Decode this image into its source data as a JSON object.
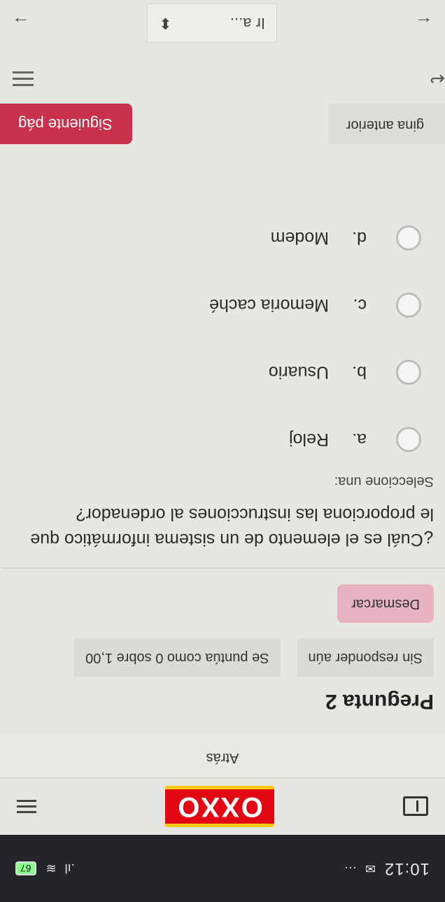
{
  "status_bar": {
    "time": "10:12",
    "more": "···",
    "signal": ".ıl",
    "battery": "67"
  },
  "header": {
    "logo": "OXXO"
  },
  "back_link": "Atrás",
  "question": {
    "title": "Pregunta 2",
    "status": "Sin responder aún",
    "score": "Se puntúa como 0 sobre 1,00",
    "flag_label": "Desmarcar",
    "text": "¿Cuál es el elemento de un sistema informático que le proporciona las instrucciones al ordenador?",
    "prompt": "Seleccione una:",
    "options": [
      {
        "letter": "a.",
        "text": "Reloj"
      },
      {
        "letter": "b.",
        "text": "Usuario"
      },
      {
        "letter": "c.",
        "text": "Memoria caché"
      },
      {
        "letter": "d.",
        "text": "Modem"
      }
    ]
  },
  "nav": {
    "prev_label": "gina anterior",
    "next_label": "Siguiente pág",
    "jump_placeholder": "Ir a...",
    "left_arrow": "←",
    "right_arrow": "→",
    "collapse_arrow": "↩"
  },
  "colors": {
    "accent": "#c8314c",
    "flag": "#e7b3c3",
    "logo_red": "#e30613",
    "logo_yellow": "#f6c80f"
  }
}
